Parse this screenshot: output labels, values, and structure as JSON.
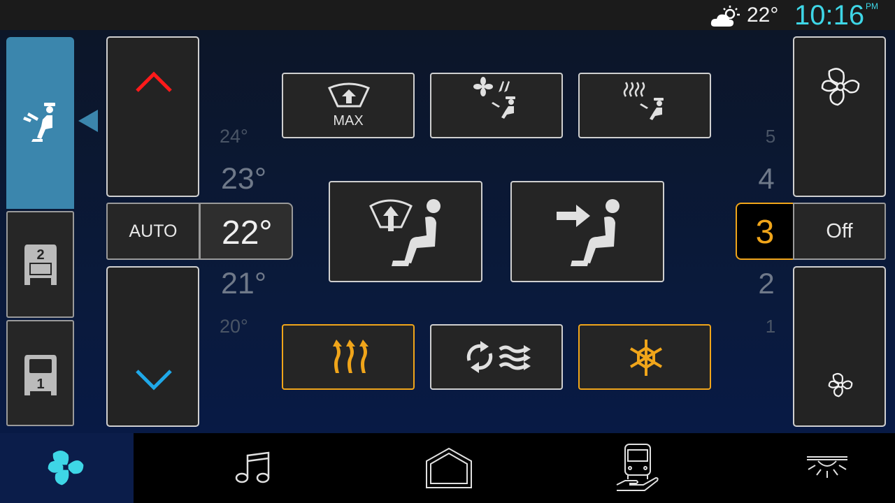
{
  "status_bar": {
    "weather_icon": "partly-cloudy-icon",
    "outside_temp": "22°",
    "time": "10:16",
    "ampm": "PM"
  },
  "zones": [
    {
      "name": "driver",
      "icon": "seated-driver-icon",
      "selected": true
    },
    {
      "name": "row-2",
      "icon": "seat-row-2-icon",
      "label": "2",
      "selected": false
    },
    {
      "name": "row-1",
      "icon": "seat-row-1-icon",
      "label": "1",
      "selected": false
    }
  ],
  "temperature": {
    "auto_label": "AUTO",
    "current": "22°",
    "scale_above": [
      "24°",
      "23°"
    ],
    "scale_below": [
      "21°",
      "20°"
    ],
    "up_icon": "chevron-up-icon",
    "down_icon": "chevron-down-icon",
    "up_color": "#ff1a1a",
    "down_color": "#1fa8e8"
  },
  "airflow_buttons": {
    "max_defrost_label": "MAX",
    "top_row": [
      "max-windshield-defrost",
      "fan-to-upper",
      "heat-to-upper"
    ],
    "large": [
      "windshield-and-feet",
      "face-vent"
    ],
    "bottom_row": [
      {
        "name": "heat",
        "active": true
      },
      {
        "name": "recirculation",
        "active": false
      },
      {
        "name": "ac",
        "active": true
      }
    ],
    "active_color": "#f0a51a"
  },
  "fan_speed": {
    "current": "3",
    "off_label": "Off",
    "scale_above": [
      "5",
      "4"
    ],
    "scale_below": [
      "2",
      "1"
    ],
    "up_icon": "fan-large-icon",
    "down_icon": "fan-small-icon"
  },
  "bottom_nav": [
    {
      "name": "climate",
      "icon": "fan-icon",
      "active": true
    },
    {
      "name": "music",
      "icon": "music-note-icon",
      "active": false
    },
    {
      "name": "home",
      "icon": "home-icon",
      "active": false
    },
    {
      "name": "vehicle",
      "icon": "bus-hand-icon",
      "active": false
    },
    {
      "name": "lights",
      "icon": "ceiling-light-icon",
      "active": false
    }
  ]
}
